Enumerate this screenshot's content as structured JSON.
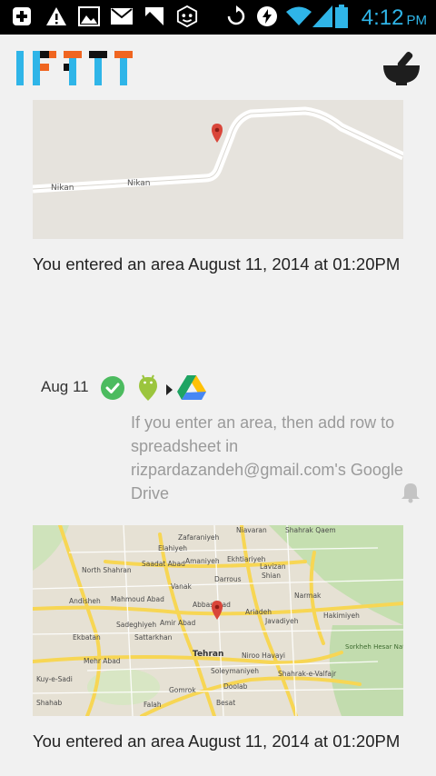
{
  "status_bar": {
    "time": "4:12",
    "ampm": "PM",
    "icons": [
      "add-notification-icon",
      "warning-icon",
      "image-icon",
      "mail-icon",
      "flag-icon",
      "robot-app-icon",
      "sync-icon",
      "battery-saver-icon",
      "wifi-icon",
      "signal-icon",
      "battery-icon"
    ]
  },
  "header": {
    "logo_text": "IFTTT",
    "menu_icon": "mortar-pestle-icon"
  },
  "feed": {
    "entry1": {
      "map_labels": [
        "Nikan",
        "Nikan"
      ],
      "text": "You entered an area August 11, 2014 at 01:20PM"
    },
    "recipe": {
      "date": "Aug 11",
      "status_icon": "check-circle-icon",
      "trigger_icon": "android-location-icon",
      "action_icon": "google-drive-icon",
      "description": "If you enter an area, then add row to spreadsheet in rizpardazandeh@gmail.com's Google Drive"
    },
    "entry2": {
      "map_labels": [
        "Niavaran",
        "Shahrak Qaem",
        "Zafaraniyeh",
        "Elahiyeh",
        "North Shahran",
        "Saadat Abad",
        "Amaniyeh",
        "Ekhtiariyeh",
        "Darrous",
        "Lavizan",
        "Shian",
        "Mahmoud Abad",
        "Vanak",
        "Narmak",
        "Hakimiyeh",
        "Andisheh",
        "Abbasabad",
        "Ariadeh",
        "Javadiyeh",
        "Sadeghiyeh",
        "Amir Abad",
        "Sattarkhan",
        "Ekbatan",
        "Tehran",
        "Niroo Havayi",
        "Sorkheh Hesar National Park",
        "Mehr Abad",
        "Soleymaniyeh",
        "Shahrak-e-Valfajr",
        "Doolab",
        "Gomrok",
        "Shahab",
        "Falah",
        "Besat",
        "Kuy-e-Sadi"
      ],
      "text": "You entered an area August 11, 2014 at 01:20PM"
    }
  },
  "colors": {
    "accent": "#2fb5e8",
    "check": "#4cbb5f",
    "android": "#9bc53d",
    "pin": "#d9463a"
  }
}
